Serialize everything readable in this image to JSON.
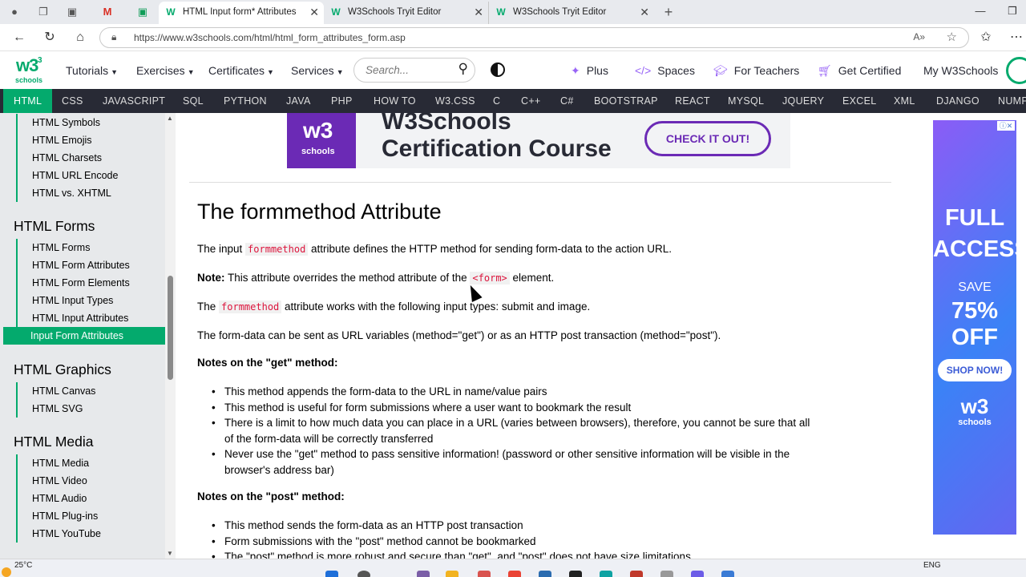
{
  "browser": {
    "tabs": [
      {
        "title": "HTML Input form* Attributes",
        "active": true
      },
      {
        "title": "W3Schools Tryit Editor",
        "active": false
      },
      {
        "title": "W3Schools Tryit Editor",
        "active": false
      }
    ],
    "url": "https://www.w3schools.com/html/html_form_attributes_form.asp"
  },
  "topnav": {
    "logo_text": "w3",
    "logo_sup": "3",
    "logo_sub": "schools",
    "menus": [
      "Tutorials",
      "Exercises",
      "Certificates",
      "Services"
    ],
    "search_placeholder": "Search...",
    "links": [
      "Plus",
      "Spaces",
      "For Teachers",
      "Get Certified",
      "My W3Schools"
    ]
  },
  "langbar": [
    "HTML",
    "CSS",
    "JAVASCRIPT",
    "SQL",
    "PYTHON",
    "JAVA",
    "PHP",
    "HOW TO",
    "W3.CSS",
    "C",
    "C++",
    "C#",
    "BOOTSTRAP",
    "REACT",
    "MYSQL",
    "JQUERY",
    "EXCEL",
    "XML",
    "DJANGO",
    "NUMP"
  ],
  "sidebar": {
    "top_items": [
      "HTML Symbols",
      "HTML Emojis",
      "HTML Charsets",
      "HTML URL Encode",
      "HTML vs. XHTML"
    ],
    "forms_heading": "HTML Forms",
    "forms_items": [
      "HTML Forms",
      "HTML Form Attributes",
      "HTML Form Elements",
      "HTML Input Types",
      "HTML Input Attributes",
      "Input Form Attributes"
    ],
    "graphics_heading": "HTML Graphics",
    "graphics_items": [
      "HTML Canvas",
      "HTML SVG"
    ],
    "media_heading": "HTML Media",
    "media_items": [
      "HTML Media",
      "HTML Video",
      "HTML Audio",
      "HTML Plug-ins",
      "HTML YouTube"
    ]
  },
  "banner": {
    "logo": "w3",
    "logo_sub": "schools",
    "line1": "W3Schools",
    "line2": "Certification Course",
    "cta": "CHECK IT OUT!"
  },
  "content": {
    "title": "The formmethod Attribute",
    "p1_pre": "The input ",
    "p1_code": "formmethod",
    "p1_post": " attribute defines the HTTP method for sending form-data to the action URL.",
    "note_label": "Note:",
    "note_pre": " This attribute overrides the method attribute of the ",
    "note_code": "<form>",
    "note_post": " element.",
    "p3_pre": "The ",
    "p3_code": "formmethod",
    "p3_post": " attribute works with the following input types: submit and image.",
    "p4": "The form-data can be sent as URL variables (method=\"get\") or as an HTTP post transaction (method=\"post\").",
    "get_heading": "Notes on the \"get\" method:",
    "get_items": [
      "This method appends the form-data to the URL in name/value pairs",
      "This method is useful for form submissions where a user want to bookmark the result",
      "There is a limit to how much data you can place in a URL (varies between browsers), therefore, you cannot be sure that all",
      "of the form-data will be correctly transferred",
      "Never use the \"get\" method to pass sensitive information! (password or other sensitive information will be visible in the",
      "browser's address bar)"
    ],
    "post_heading": "Notes on the \"post\" method:",
    "post_items": [
      "This method sends the form-data as an HTTP post transaction",
      "Form submissions with the \"post\" method cannot be bookmarked",
      "The \"post\" method is more robust and secure than \"get\", and \"post\" does not have size limitations"
    ]
  },
  "ad": {
    "line1": "FULL",
    "line2": "ACCESS",
    "line3": "SAVE",
    "line4": "75% OFF",
    "button": "SHOP NOW!",
    "logo": "w3",
    "logo_sub": "schools"
  },
  "taskbar": {
    "temperature": "25°C",
    "language": "ENG"
  },
  "colors": {
    "brand_green": "#04aa6d",
    "dark_bar": "#282a35",
    "code_red": "#dc143c",
    "banner_purple": "#6b2ab5"
  }
}
